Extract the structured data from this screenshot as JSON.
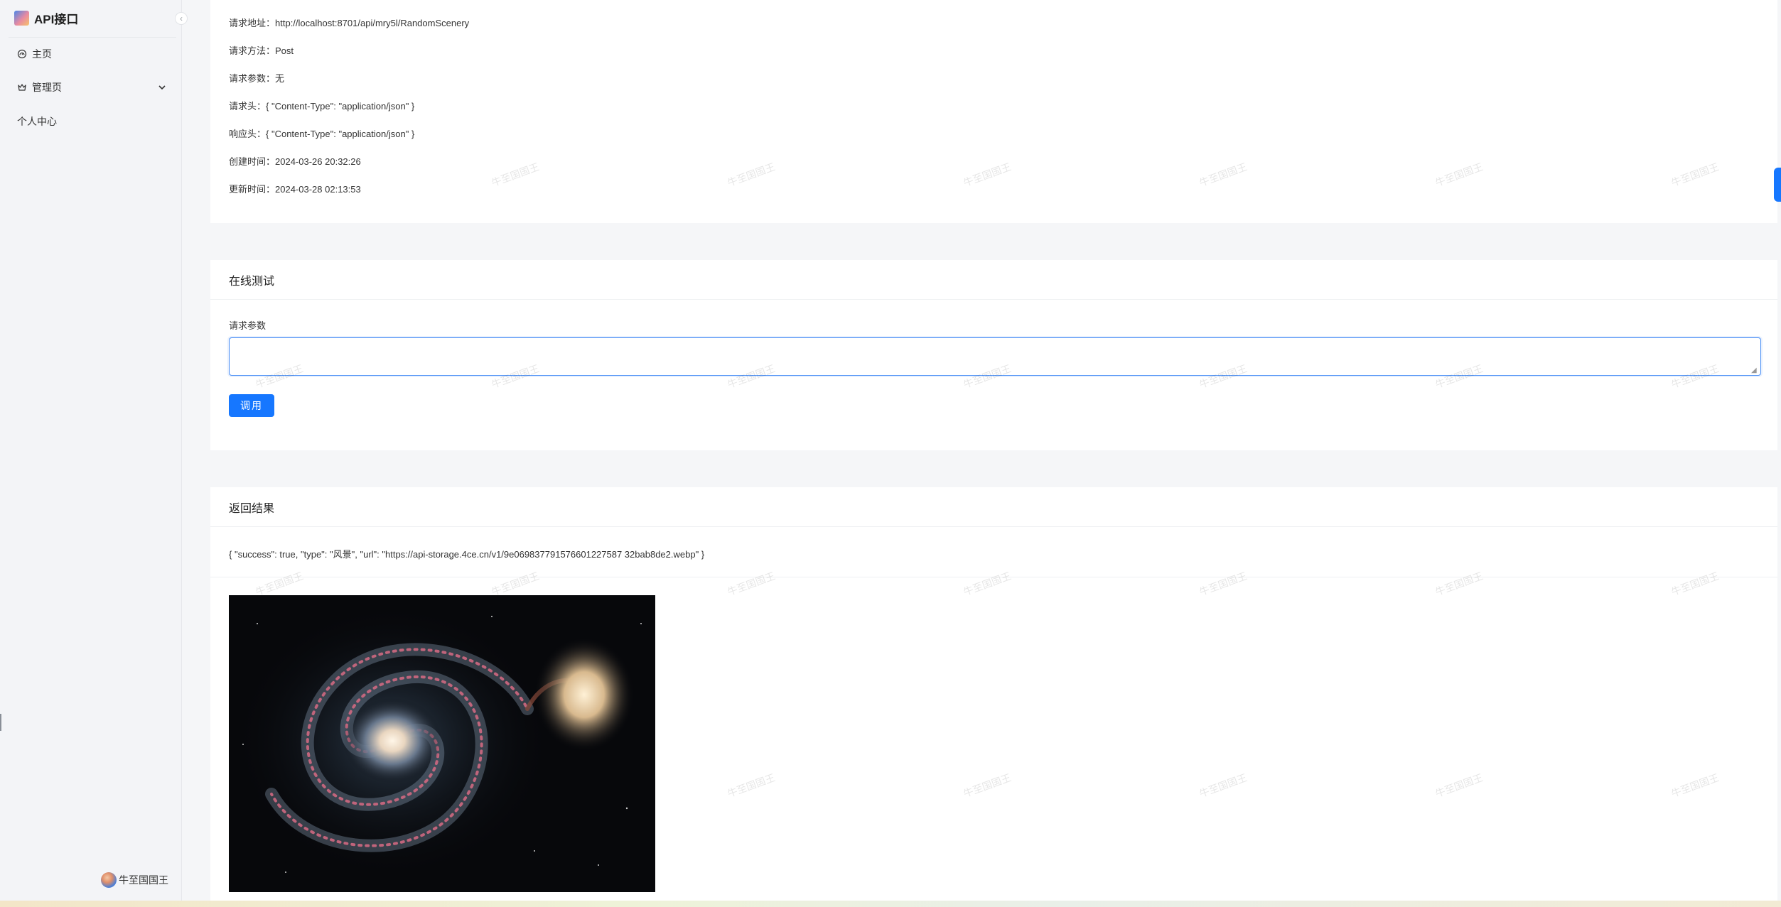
{
  "app": {
    "title": "API接口"
  },
  "sidebar": {
    "items": [
      {
        "label": "主页",
        "icon": "dashboard-icon"
      },
      {
        "label": "管理页",
        "icon": "crown-icon"
      },
      {
        "label": "个人中心",
        "icon": ""
      }
    ],
    "user_name": "牛至国国王"
  },
  "info": {
    "rows": [
      {
        "key": "请求地址：",
        "value": "http://localhost:8701/api/mry5l/RandomScenery"
      },
      {
        "key": "请求方法：",
        "value": "Post"
      },
      {
        "key": "请求参数：",
        "value": "无"
      },
      {
        "key": "请求头：",
        "value": "{ \"Content-Type\": \"application/json\" }"
      },
      {
        "key": "响应头：",
        "value": "{ \"Content-Type\": \"application/json\" }"
      },
      {
        "key": "创建时间：",
        "value": "2024-03-26 20:32:26"
      },
      {
        "key": "更新时间：",
        "value": "2024-03-28 02:13:53"
      }
    ]
  },
  "test": {
    "title": "在线测试",
    "param_label": "请求参数",
    "param_value": "",
    "call_button": "调用"
  },
  "result": {
    "title": "返回结果",
    "json_text": "{ \"success\": true, \"type\": \"风景\", \"url\": \"https://api-storage.4ce.cn/v1/9e069837791576601227587 32bab8de2.webp\" }"
  },
  "watermark": "牛至国国王",
  "colors": {
    "primary": "#1677ff",
    "background": "#f5f6f8",
    "card": "#ffffff"
  }
}
